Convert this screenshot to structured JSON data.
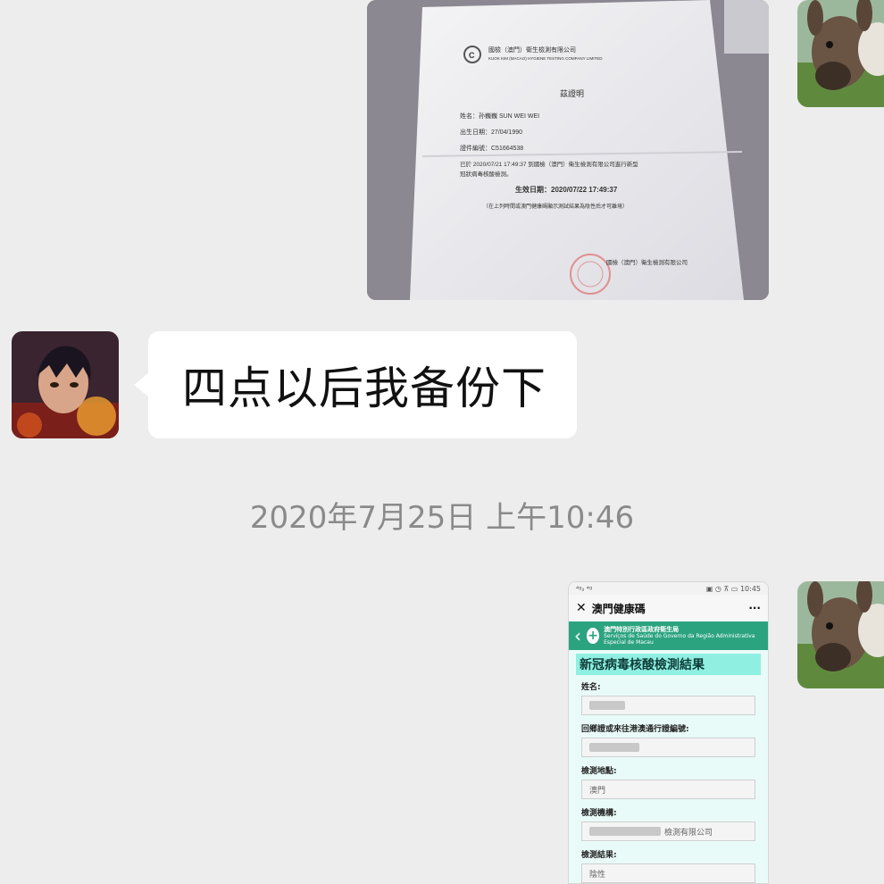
{
  "messages": {
    "photo": {
      "company_cn": "國檢（澳門）衛生檢測有限公司",
      "company_en": "KUOK KIM (MACAO) HYGIENE TESTING COMPANY LIMITED",
      "doc_title": "茲證明",
      "name_line": "姓名：孙巍巍 SUN WEI WEI",
      "dob_line": "出生日期：27/04/1990",
      "id_line": "證件編號：C51664538",
      "body_line1": "已於 2020/07/21 17:49:37 到國檢（澳門）衛生檢測有限公司進行新型",
      "body_line2": "冠狀病毒核酸檢測。",
      "effective": "生效日期：2020/07/22 17:49:37",
      "note": "（在上列時間或澳門健康碼顯示測試結果為陰性后才可離境）",
      "signature": "國檢（澳門）衛生檢測有限公司"
    },
    "text": "四点以后我备份下",
    "timestamp": "2020年7月25日 上午10:46",
    "screenshot": {
      "status_left": "⁴ᵍᵢₗ ⁴ᵍ",
      "status_right": "▣ ◷ ⊼ ▭ 10:45",
      "app_title": "澳門健康碼",
      "more": "···",
      "dept_cn": "澳門特別行政區政府衛生局",
      "dept_pt": "Serviços de Saúde do Governo da Região Administrativa Especial de Macau",
      "heading": "新冠病毒核酸檢測結果",
      "fields": {
        "name_label": "姓名:",
        "permit_label": "回鄉證或來往港澳通行證編號:",
        "location_label": "檢測地點:",
        "location_value": "澳門",
        "org_label": "檢測機構:",
        "org_value": "檢測有限公司",
        "result_label": "檢測結果:",
        "result_value": "陰性"
      }
    }
  },
  "icons": [
    "donkey-avatar-icon",
    "anime-avatar-icon",
    "close-icon",
    "back-arrow-icon",
    "health-cross-icon",
    "more-icon"
  ]
}
